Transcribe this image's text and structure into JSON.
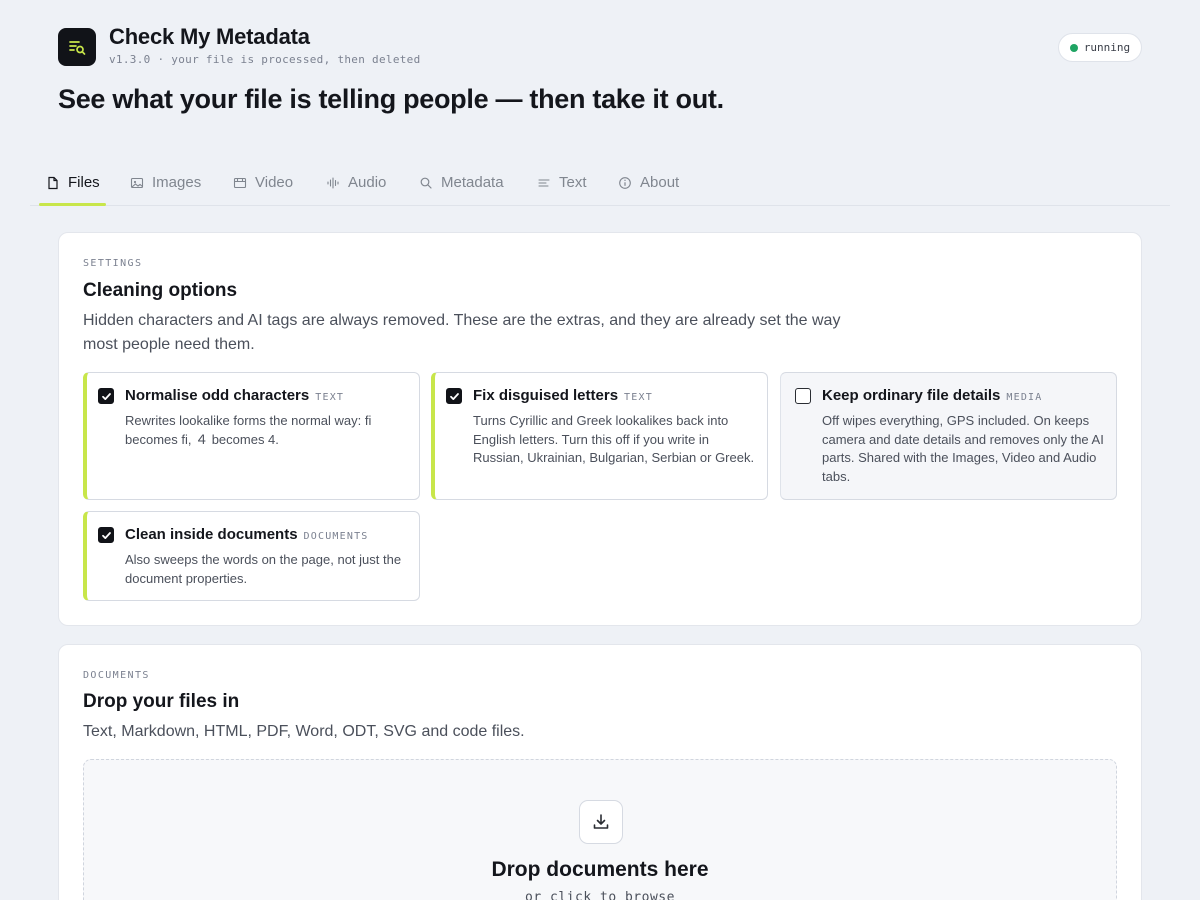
{
  "header": {
    "logo_icon": "document-search-icon",
    "app_name": "Check My Metadata",
    "subtitle": "v1.3.0 · your file is processed, then deleted",
    "status": "running",
    "status_color": "#1fa463",
    "headline": "See what your file is telling people — then take it out."
  },
  "tabs": [
    {
      "label": "Files",
      "icon": "file-icon",
      "active": true
    },
    {
      "label": "Images",
      "icon": "image-icon",
      "active": false
    },
    {
      "label": "Video",
      "icon": "video-icon",
      "active": false
    },
    {
      "label": "Audio",
      "icon": "audio-wave-icon",
      "active": false
    },
    {
      "label": "Metadata",
      "icon": "search-icon",
      "active": false
    },
    {
      "label": "Text",
      "icon": "text-lines-icon",
      "active": false
    },
    {
      "label": "About",
      "icon": "info-icon",
      "active": false
    }
  ],
  "settings": {
    "eyebrow": "SETTINGS",
    "title": "Cleaning options",
    "description": "Hidden characters and AI tags are always removed. These are the extras, and they are already set the way most people need them.",
    "options": [
      {
        "title": "Normalise odd characters",
        "tag": "TEXT",
        "checked": true,
        "description": "Rewrites lookalike forms the normal way: ﬁ becomes fi, ４ becomes 4."
      },
      {
        "title": "Fix disguised letters",
        "tag": "TEXT",
        "checked": true,
        "description": "Turns Cyrillic and Greek lookalikes back into English letters. Turn this off if you write in Russian, Ukrainian, Bulgarian, Serbian or Greek."
      },
      {
        "title": "Keep ordinary file details",
        "tag": "MEDIA",
        "checked": false,
        "description": "Off wipes everything, GPS included. On keeps camera and date details and removes only the AI parts. Shared with the Images, Video and Audio tabs."
      },
      {
        "title": "Clean inside documents",
        "tag": "DOCUMENTS",
        "checked": true,
        "description": "Also sweeps the words on the page, not just the document properties."
      }
    ]
  },
  "documents": {
    "eyebrow": "DOCUMENTS",
    "title": "Drop your files in",
    "description": "Text, Markdown, HTML, PDF, Word, ODT, SVG and code files.",
    "drop_icon": "download-icon",
    "drop_title": "Drop documents here",
    "drop_sub": "or click to browse"
  },
  "colors": {
    "accent": "#c8e64a",
    "background": "#eef1f6"
  }
}
